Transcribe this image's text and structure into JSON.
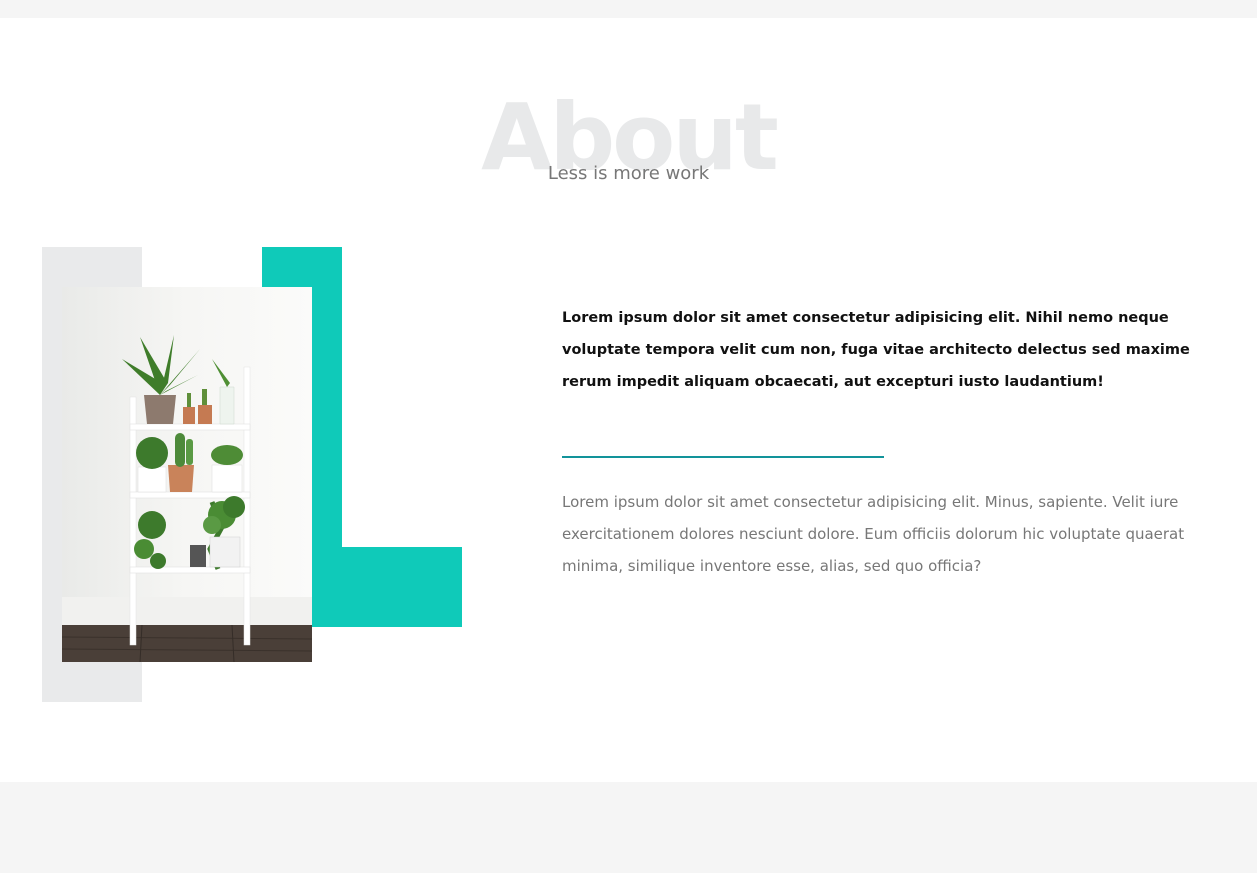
{
  "about": {
    "bg_title": "About",
    "subtitle": "Less is more work",
    "lead": "Lorem ipsum dolor sit amet consectetur adipisicing elit. Nihil nemo neque voluptate tempora velit cum non, fuga vitae architecto delectus sed maxime rerum impedit aliquam obcaecati, aut excepturi iusto laudantium!",
    "body": "Lorem ipsum dolor sit amet consectetur adipisicing elit. Minus, sapiente. Velit iure exercitationem dolores nesciunt dolore. Eum officiis dolorum hic voluptate quaerat minima, similique inventore esse, alias, sed quo officia?",
    "image_icon": "plant-shelf-photo"
  },
  "colors": {
    "accent": "#0fcab9",
    "divider": "#12939a",
    "deco_gray": "#e9eaeb",
    "section_bg": "#f5f5f5"
  }
}
